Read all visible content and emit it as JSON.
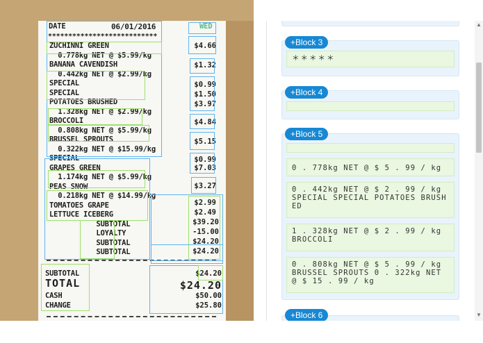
{
  "receipt": {
    "header_date_label": "DATE",
    "header_date": "06/01/2016",
    "header_day": "WED",
    "stars": "***************************",
    "items_left": [
      "ZUCHINNI GREEN",
      "  0.778kg NET @ $5.99/kg",
      "BANANA CAVENDISH",
      "  0.442kg NET @ $2.99/kg",
      "SPECIAL",
      "SPECIAL",
      "POTATOES BRUSHED",
      "  1.328kg NET @ $2.99/kg",
      "BROCCOLI",
      "  0.808kg NET @ $5.99/kg",
      "BRUSSEL SPROUTS",
      "  0.322kg NET @ $15.99/kg",
      "SPECIAL",
      "GRAPES GREEN",
      "  1.174kg NET @ $5.99/kg",
      "PEAS SNOW",
      "  0.218kg NET @ $14.99/kg",
      "TOMATOES GRAPE",
      "LETTUCE ICEBERG",
      "           SUBTOTAL",
      "           LOYALTY",
      "           SUBTOTAL",
      "           SUBTOTAL"
    ],
    "prices": [
      "$4.66",
      "$1.32",
      "$0.99",
      "$1.50",
      "$3.97",
      "$4.84",
      "$5.15",
      "$0.99",
      "$7.03",
      "$3.27",
      "$2.99",
      "$2.49",
      "$39.20",
      "-15.00",
      "$24.20",
      "$24.20"
    ],
    "footer_labels": [
      "SUBTOTAL",
      "TOTAL",
      "CASH",
      "CHANGE"
    ],
    "footer_values": [
      "$24.20",
      "$24.20",
      "$50.00",
      "$25.80"
    ]
  },
  "panel": {
    "blocks": [
      {
        "label": "+Block 3",
        "lines": [
          "＊＊＊＊＊"
        ]
      },
      {
        "label": "+Block 4",
        "lines": [
          ""
        ]
      },
      {
        "label": "+Block 5",
        "lines": [
          "",
          "0 . 778kg NET @ $ 5 . 99 / kg",
          "0 . 442kg NET @ $ 2 . 99 / kg SPECIAL SPECIAL POTATOES BRUSHED",
          "1 . 328kg NET @ $ 2 . 99 / kg BROCCOLI",
          "0 . 808kg NET @ $ 5 . 99 / kg BRUSSEL SPROUTS 0 . 322kg NET @ $ 15 . 99 / kg"
        ]
      },
      {
        "label": "+Block 6",
        "lines": []
      }
    ]
  }
}
